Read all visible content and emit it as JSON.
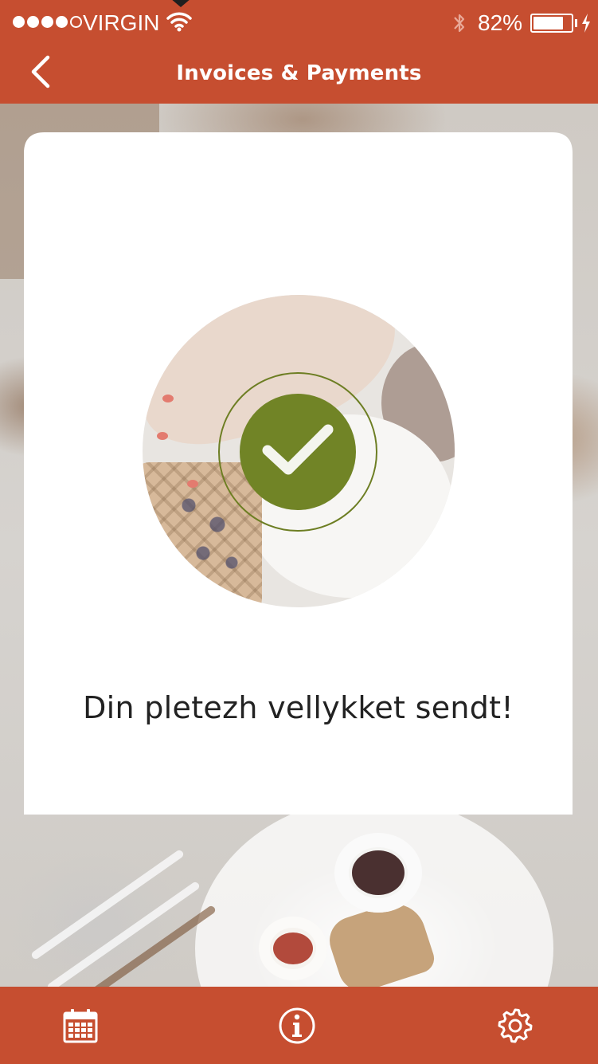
{
  "status_bar": {
    "carrier": "VIRGIN",
    "signal_bars_filled": 4,
    "signal_bars_total": 5,
    "battery_percent_label": "82%",
    "battery_level": 0.82
  },
  "nav": {
    "title": "Invoices & Payments",
    "back_icon": "chevron-left-icon"
  },
  "content": {
    "message": "Din pletezh vellykket sendt!",
    "status_icon": "check-icon"
  },
  "tab_bar": {
    "items": [
      {
        "icon": "calendar-icon"
      },
      {
        "icon": "info-icon"
      },
      {
        "icon": "gear-icon"
      }
    ]
  },
  "colors": {
    "brand": "#c64e30",
    "success": "#718426",
    "card": "#ffffff"
  }
}
